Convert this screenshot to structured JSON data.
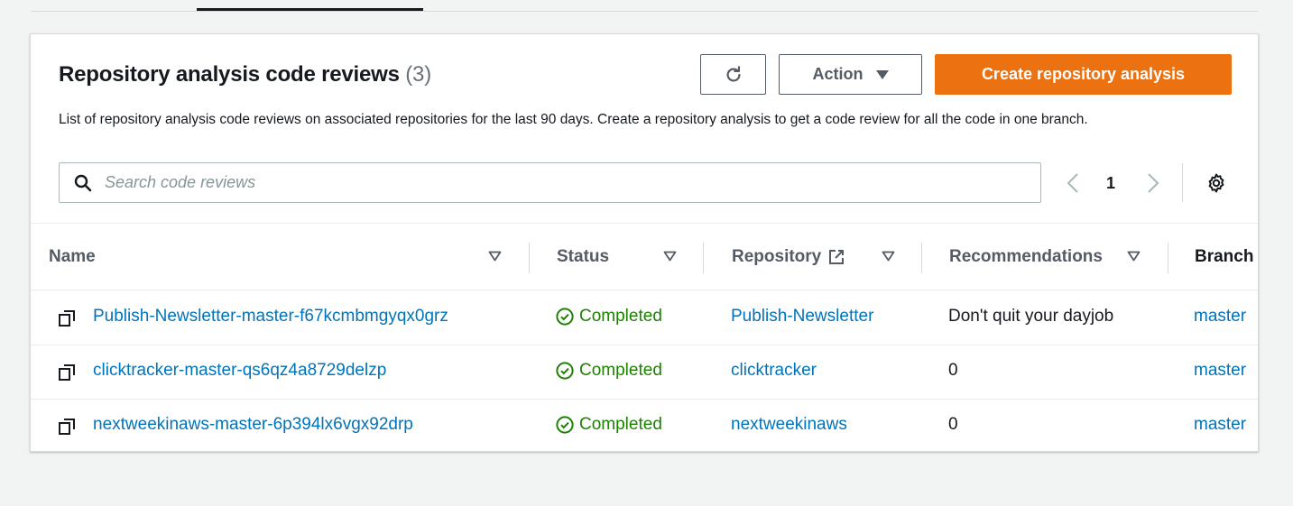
{
  "panel": {
    "title": "Repository analysis code reviews",
    "count": "(3)",
    "description": "List of repository analysis code reviews on associated repositories for the last 90 days. Create a repository analysis to get a code review for all the code in one branch."
  },
  "toolbar": {
    "refresh_icon": "refresh-icon",
    "action_label": "Action",
    "create_label": "Create repository analysis"
  },
  "search": {
    "placeholder": "Search code reviews",
    "value": ""
  },
  "pagination": {
    "current_page": "1"
  },
  "table": {
    "columns": [
      "Name",
      "Status",
      "Repository",
      "Recommendations",
      "Branch"
    ],
    "rows": [
      {
        "name": "Publish-Newsletter-master-f67kcmbmgyqx0grz",
        "status": "Completed",
        "repository": "Publish-Newsletter",
        "recommendations": "Don't quit your dayjob",
        "branch": "master"
      },
      {
        "name": "clicktracker-master-qs6qz4a8729delzp",
        "status": "Completed",
        "repository": "clicktracker",
        "recommendations": "0",
        "branch": "master"
      },
      {
        "name": "nextweekinaws-master-6p394lx6vgx92drp",
        "status": "Completed",
        "repository": "nextweekinaws",
        "recommendations": "0",
        "branch": "master"
      }
    ]
  },
  "colors": {
    "primary": "#ec7211",
    "link": "#0073bb",
    "success": "#1d8102",
    "text": "#16191f",
    "muted": "#545b64"
  }
}
